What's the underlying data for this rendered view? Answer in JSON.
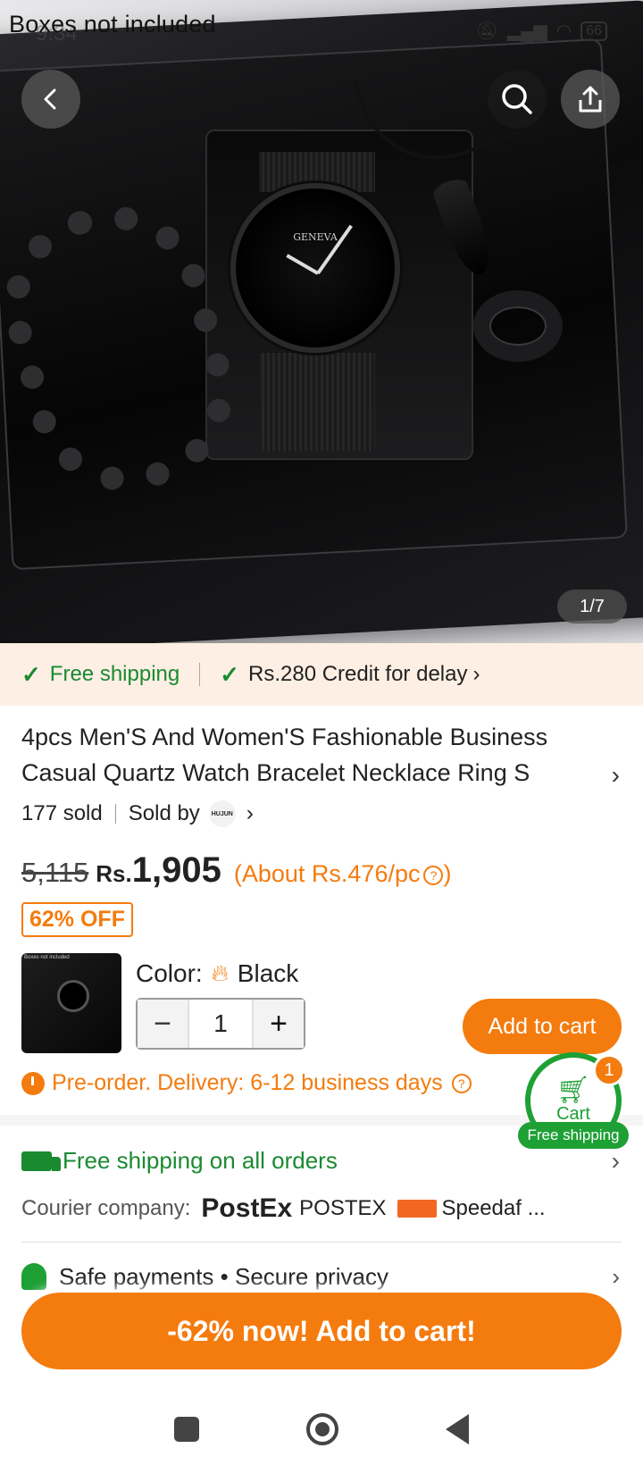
{
  "status_bar": {
    "time": "9:34",
    "battery": "66"
  },
  "hero": {
    "caption": "Boxes not included",
    "watch_brand": "GENEVA",
    "image_counter": "1/7",
    "thumb_caption": "Boxes not included"
  },
  "shipping_banner": {
    "free_shipping": "Free shipping",
    "credit": "Rs.280 Credit for delay",
    "credit_chevron": "›"
  },
  "product": {
    "title": "4pcs Men'S And Women'S Fashionable Business Casual Quartz Watch Bracelet Necklace Ring S",
    "sold": "177 sold",
    "sold_by_label": "Sold by",
    "seller_logo_text": "HUJUN",
    "old_price": "5,115",
    "currency": "Rs.",
    "price": "1,905",
    "per_piece": "(About Rs.476/pc",
    "per_piece_close": ")",
    "discount": "62% OFF",
    "color_label": "Color:",
    "color_value": "Black",
    "quantity": "1",
    "add_to_cart": "Add to cart",
    "preorder": "Pre-order. Delivery: 6-12 business days"
  },
  "cart_float": {
    "label": "Cart",
    "badge": "1",
    "free_shipping": "Free shipping"
  },
  "shipping": {
    "free_all": "Free shipping on all orders",
    "courier_label": "Courier company:",
    "postex_logo": "PostEx",
    "postex_name": "POSTEX",
    "speedaf_name": "Speedaf ..."
  },
  "safety": {
    "text": "Safe payments • Secure privacy"
  },
  "cta": {
    "label": "-62% now! Add to cart!"
  },
  "icons": {
    "back": "back-arrow-icon",
    "search": "search-icon",
    "share": "share-icon",
    "check": "check-icon",
    "cart": "cart-icon",
    "truck": "truck-icon",
    "shield": "shield-icon",
    "clock": "clock-icon"
  },
  "colors": {
    "accent": "#f47b0e",
    "green": "#1a8a31",
    "banner_bg": "#fdefe4"
  }
}
